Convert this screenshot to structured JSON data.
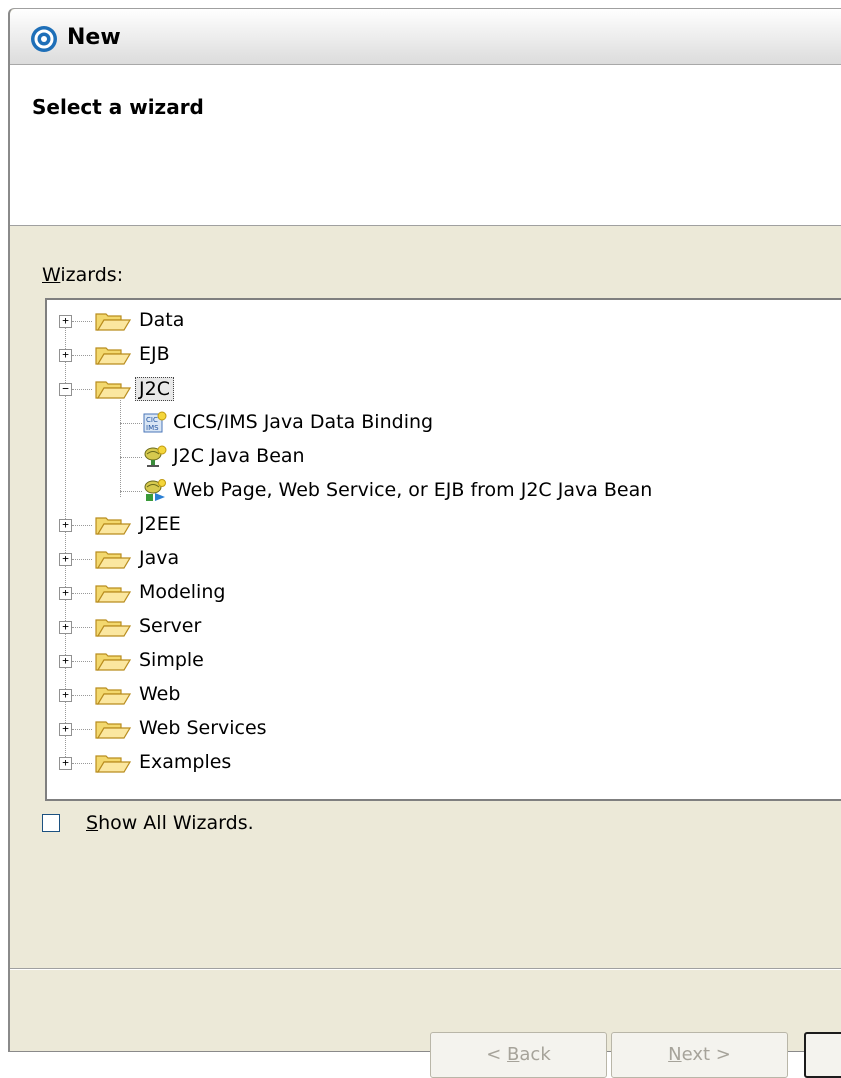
{
  "window": {
    "title": "New",
    "app_icon": "eclipse-icon"
  },
  "banner": {
    "title": "Select a wizard"
  },
  "wizards": {
    "label": "Wizards:",
    "tree": [
      {
        "label": "Data",
        "expanded": false
      },
      {
        "label": "EJB",
        "expanded": false
      },
      {
        "label": "J2C",
        "expanded": true,
        "selected": true,
        "children": [
          {
            "label": "CICS/IMS Java Data Binding",
            "icon": "cics-ims-icon"
          },
          {
            "label": "J2C Java Bean",
            "icon": "java-bean-icon"
          },
          {
            "label": "Web Page, Web Service, or EJB from J2C Java Bean",
            "icon": "web-bean-icon"
          }
        ]
      },
      {
        "label": "J2EE",
        "expanded": false
      },
      {
        "label": "Java",
        "expanded": false
      },
      {
        "label": "Modeling",
        "expanded": false
      },
      {
        "label": "Server",
        "expanded": false
      },
      {
        "label": "Simple",
        "expanded": false
      },
      {
        "label": "Web",
        "expanded": false
      },
      {
        "label": "Web Services",
        "expanded": false
      },
      {
        "label": "Examples",
        "expanded": false
      }
    ]
  },
  "show_all": {
    "label": "Show All Wizards.",
    "checked": false
  },
  "buttons": {
    "back": "< Back",
    "next": "Next >"
  },
  "colors": {
    "folder": "#f3d86e",
    "folder_edge": "#b98d1f",
    "selection": "#e8e8e8"
  }
}
